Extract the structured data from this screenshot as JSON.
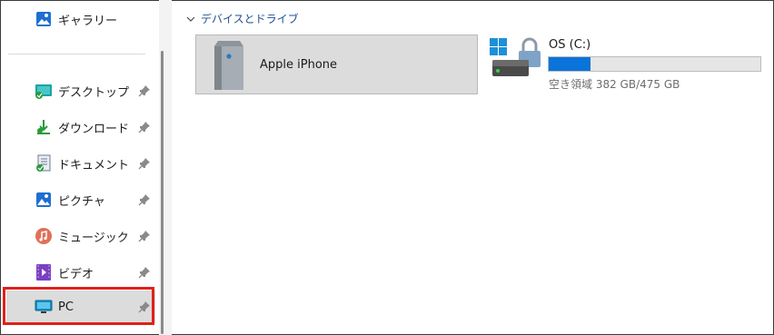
{
  "sidebar": {
    "items": [
      {
        "label": "ギャラリー",
        "icon": "gallery-icon",
        "pinned": false
      },
      {
        "label": "デスクトップ",
        "icon": "desktop-folder-icon",
        "pinned": true
      },
      {
        "label": "ダウンロード",
        "icon": "download-icon",
        "pinned": true
      },
      {
        "label": "ドキュメント",
        "icon": "documents-icon",
        "pinned": true
      },
      {
        "label": "ピクチャ",
        "icon": "pictures-icon",
        "pinned": true
      },
      {
        "label": "ミュージック",
        "icon": "music-icon",
        "pinned": true
      },
      {
        "label": "ビデオ",
        "icon": "video-icon",
        "pinned": true
      },
      {
        "label": "PC",
        "icon": "pc-icon",
        "pinned": true,
        "selected": true
      }
    ]
  },
  "main": {
    "section_title": "デバイスとドライブ",
    "device": {
      "label": "Apple iPhone",
      "icon": "phone-device-icon"
    },
    "drive": {
      "name": "OS (C:)",
      "free_text": "空き領域 382 GB/475 GB",
      "used_fraction": 0.196,
      "bar_color": "#0a74da"
    }
  },
  "colors": {
    "highlight_border": "#e0201b",
    "section_title": "#1d4f91",
    "selected_bg": "#dcdcdc"
  }
}
